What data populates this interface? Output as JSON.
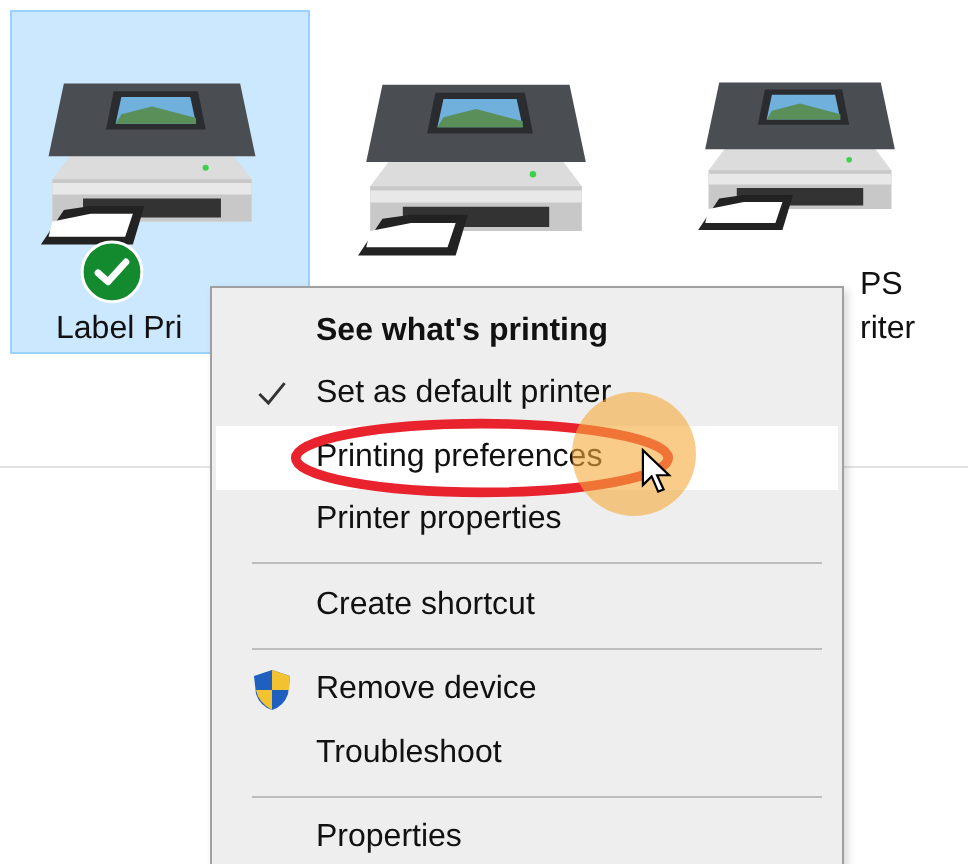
{
  "printers": [
    {
      "label_lines": [
        "Label Pri"
      ],
      "selected": true,
      "default": true
    },
    {
      "selected": false,
      "default": false
    },
    {
      "label_lines": [
        "PS",
        "riter"
      ],
      "selected": false,
      "default": false
    }
  ],
  "context_menu": {
    "items": [
      {
        "kind": "item",
        "label": "See what's printing",
        "bold": true,
        "checked": false,
        "highlighted": false
      },
      {
        "kind": "item",
        "label": "Set as default printer",
        "bold": false,
        "checked": true,
        "highlighted": false
      },
      {
        "kind": "item",
        "label": "Printing preferences",
        "bold": false,
        "checked": false,
        "highlighted": true
      },
      {
        "kind": "item",
        "label": "Printer properties",
        "bold": false,
        "checked": false,
        "highlighted": false
      },
      {
        "kind": "separator"
      },
      {
        "kind": "item",
        "label": "Create shortcut",
        "bold": false,
        "checked": false,
        "highlighted": false
      },
      {
        "kind": "separator"
      },
      {
        "kind": "shielded",
        "label": "Remove device",
        "bold": false,
        "checked": false,
        "highlighted": false
      },
      {
        "kind": "item",
        "label": "Troubleshoot",
        "bold": false,
        "checked": false,
        "highlighted": false
      },
      {
        "kind": "separator"
      },
      {
        "kind": "item",
        "label": "Properties",
        "bold": false,
        "checked": false,
        "highlighted": false
      }
    ]
  }
}
